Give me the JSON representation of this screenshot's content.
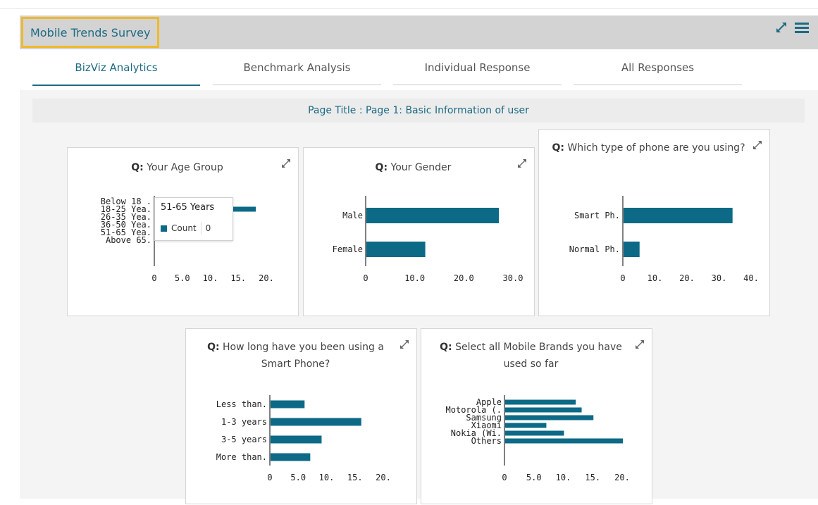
{
  "app": {
    "title": "Mobile Trends Survey",
    "accent": "#1d6b83",
    "highlight": "#f0b92a",
    "icons": [
      "expand-icon",
      "menu-icon"
    ]
  },
  "tabs": [
    {
      "label": "BizViz Analytics",
      "active": true
    },
    {
      "label": "Benchmark Analysis",
      "active": false
    },
    {
      "label": "Individual Response",
      "active": false
    },
    {
      "label": "All Responses",
      "active": false
    }
  ],
  "page_title": "Page Title : Page 1: Basic Information of user",
  "cards": [
    {
      "prefix": "Q:",
      "question": " Your Age Group"
    },
    {
      "prefix": "Q:",
      "question": " Your Gender"
    },
    {
      "prefix": "Q:",
      "question": " Which type of phone are you using?"
    },
    {
      "prefix": "Q:",
      "question": " How long have you been using a Smart Phone?"
    },
    {
      "prefix": "Q:",
      "question": " Select all Mobile Brands you have used so far"
    }
  ],
  "tooltip": {
    "title": "51-65 Years",
    "series": "Count",
    "value": "0"
  },
  "chart_data": [
    {
      "type": "bar",
      "orientation": "horizontal",
      "categories": [
        "Below 18 .",
        "18-25 Yea.",
        "26-35 Yea.",
        "36-50 Yea.",
        "51-65 Yea.",
        "Above 65."
      ],
      "values": [
        0.5,
        18,
        0.5,
        0.5,
        0,
        0
      ],
      "ticks": [
        "0",
        "5.0",
        "10.",
        "15.",
        "20."
      ],
      "xlim": [
        0,
        20
      ],
      "color": "#0c6a86"
    },
    {
      "type": "bar",
      "orientation": "horizontal",
      "categories": [
        "Male",
        "Female"
      ],
      "values": [
        27,
        12
      ],
      "ticks": [
        "0",
        "10.0",
        "20.0",
        "30.0"
      ],
      "xlim": [
        0,
        30
      ],
      "color": "#0c6a86"
    },
    {
      "type": "bar",
      "orientation": "horizontal",
      "categories": [
        "Smart Ph.",
        "Normal Ph."
      ],
      "values": [
        34,
        5
      ],
      "ticks": [
        "0",
        "10.",
        "20.",
        "30.",
        "40."
      ],
      "xlim": [
        0,
        40
      ],
      "color": "#0c6a86"
    },
    {
      "type": "bar",
      "orientation": "horizontal",
      "categories": [
        "Less than.",
        "1-3 years",
        "3-5 years",
        "More than."
      ],
      "values": [
        6,
        16,
        9,
        7
      ],
      "ticks": [
        "0",
        "5.0",
        "10.",
        "15.",
        "20."
      ],
      "xlim": [
        0,
        20
      ],
      "color": "#0c6a86"
    },
    {
      "type": "bar",
      "orientation": "horizontal",
      "categories": [
        "Apple",
        "Motorola (.",
        "Samsung",
        "Xiaomi",
        "Nokia (Wi.",
        "Others"
      ],
      "values": [
        12,
        13,
        15,
        7,
        10,
        20
      ],
      "ticks": [
        "0",
        "5.0",
        "10.",
        "15.",
        "20."
      ],
      "xlim": [
        0,
        20
      ],
      "color": "#0c6a86"
    }
  ]
}
